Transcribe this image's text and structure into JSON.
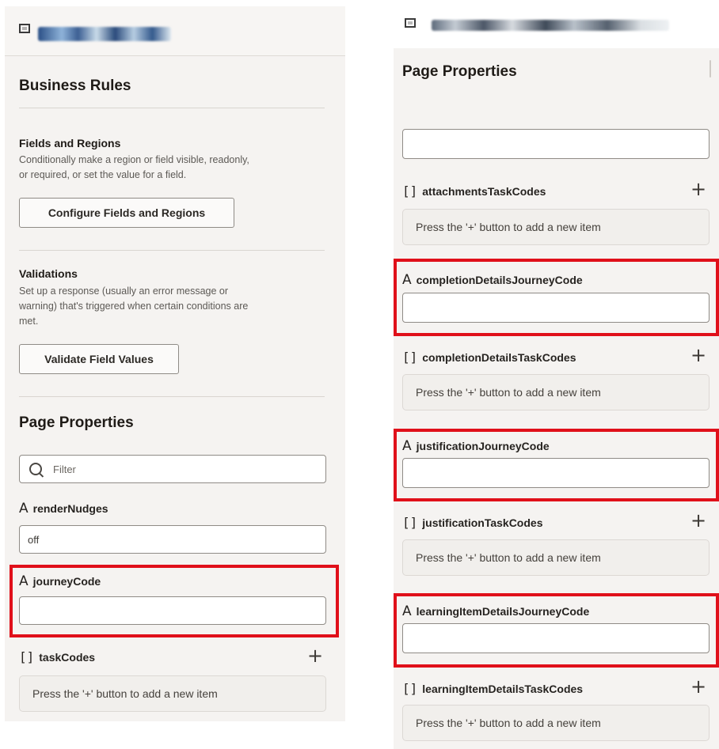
{
  "left": {
    "business_rules": {
      "title": "Business Rules",
      "fields_regions": {
        "title": "Fields and Regions",
        "desc1": "Conditionally make a region or field visible, readonly,",
        "desc2": "or required, or set the value for a field.",
        "button": "Configure Fields and Regions"
      },
      "validations": {
        "title": "Validations",
        "desc1": "Set up a response (usually an error message or",
        "desc2": "warning) that's triggered when certain conditions are",
        "desc3": "met.",
        "button": "Validate Field Values"
      }
    },
    "page_properties": {
      "title": "Page Properties",
      "filter_placeholder": "Filter",
      "fields": [
        {
          "label": "renderNudges",
          "value": "off"
        },
        {
          "label": "journeyCode",
          "value": ""
        }
      ],
      "arrays": [
        {
          "label": "taskCodes",
          "empty_text": "Press the '+' button to add a new item"
        }
      ]
    }
  },
  "right": {
    "page_properties": {
      "title": "Page Properties",
      "arrays": [
        {
          "label": "attachmentsTaskCodes",
          "empty_text": "Press the '+' button to add a new item"
        },
        {
          "label": "completionDetailsTaskCodes",
          "empty_text": "Press the '+' button to add a new item"
        },
        {
          "label": "justificationTaskCodes",
          "empty_text": "Press the '+' button to add a new item"
        },
        {
          "label": "learningItemDetailsTaskCodes",
          "empty_text": "Press the '+' button to add a new item"
        }
      ],
      "fields": [
        {
          "label": "completionDetailsJourneyCode",
          "value": ""
        },
        {
          "label": "justificationJourneyCode",
          "value": ""
        },
        {
          "label": "learningItemDetailsJourneyCode",
          "value": ""
        }
      ]
    }
  },
  "glyphs": {
    "string_type": "A",
    "array_type": "[]",
    "add": "+"
  },
  "colors": {
    "highlight": "#e0101a",
    "panel_bg": "#f5f3f1"
  }
}
